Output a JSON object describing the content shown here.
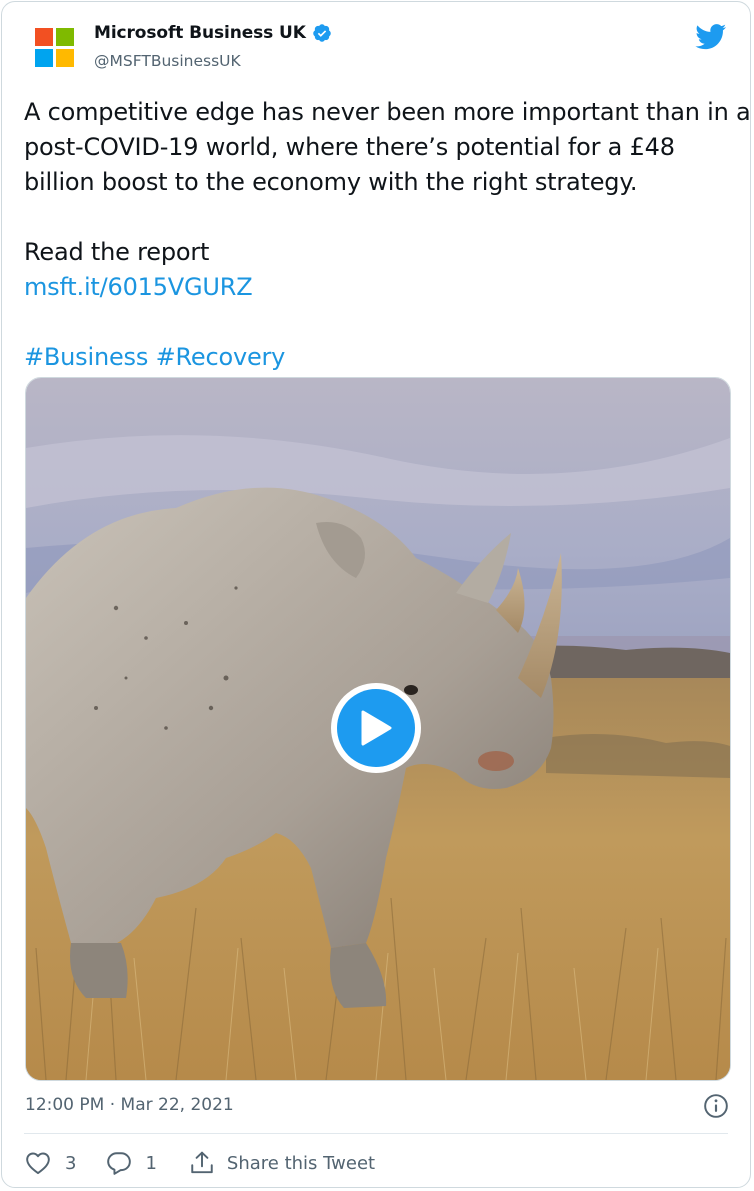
{
  "author": {
    "display_name": "Microsoft Business UK",
    "handle": "@MSFTBusinessUK",
    "logo_colors": [
      "#f25022",
      "#7fba00",
      "#00a4ef",
      "#ffb900"
    ],
    "verified_icon": "verified-badge-icon",
    "platform_icon": "twitter-bird-icon"
  },
  "tweet": {
    "lines": [
      "A competitive edge has never been more important than in a",
      "post-COVID-19 world, where there’s potential for a £48",
      "billion boost to the economy with the right strategy."
    ],
    "read_label": "Read the report",
    "link": "msft.it/6015VGURZ",
    "hashtags": [
      "#Business",
      "#Recovery"
    ]
  },
  "media": {
    "type": "video",
    "play_icon": "play-icon"
  },
  "meta": {
    "timestamp": "12:00 PM · Mar 22, 2021",
    "info_icon": "info-icon"
  },
  "actions": {
    "like_count": "3",
    "reply_count": "1",
    "share_label": "Share this Tweet"
  },
  "colors": {
    "link": "#1b95e0",
    "accent": "#1d9bf0",
    "muted": "#536471",
    "text": "#0f1419"
  }
}
